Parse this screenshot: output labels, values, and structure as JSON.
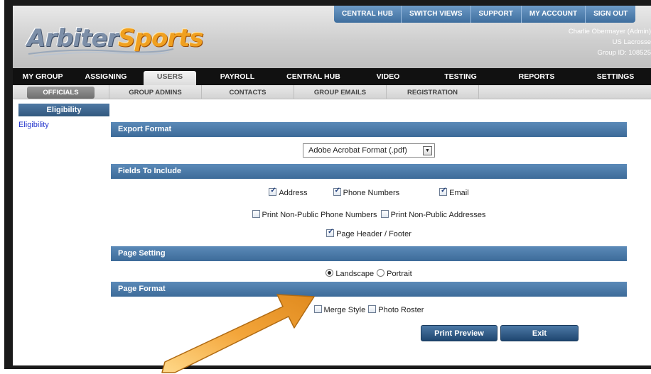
{
  "header": {
    "logo_part1": "Arbiter",
    "logo_part2": "Sports",
    "top_links": [
      "CENTRAL HUB",
      "SWITCH VIEWS",
      "SUPPORT",
      "MY ACCOUNT",
      "SIGN OUT"
    ],
    "user_name": "Charlie Obermayer (Admin)",
    "group_name": "US Lacrosse",
    "group_id": "Group ID: 108525"
  },
  "main_nav": [
    "MY GROUP",
    "ASSIGNING",
    "USERS",
    "PAYROLL",
    "CENTRAL HUB",
    "VIDEO",
    "TESTING",
    "REPORTS",
    "SETTINGS"
  ],
  "main_nav_active": "USERS",
  "sub_nav": [
    "OFFICIALS",
    "GROUP ADMINS",
    "CONTACTS",
    "GROUP EMAILS",
    "REGISTRATION"
  ],
  "sub_nav_active": "OFFICIALS",
  "sidebar": {
    "heading": "Eligibility",
    "link": "Eligibility"
  },
  "export_format": {
    "heading": "Export Format",
    "selected": "Adobe Acrobat Format (.pdf)"
  },
  "fields": {
    "heading": "Fields To Include",
    "address": {
      "label": "Address",
      "checked": true
    },
    "phone": {
      "label": "Phone Numbers",
      "checked": true
    },
    "email": {
      "label": "Email",
      "checked": true
    },
    "nonpublic_phone": {
      "label": "Print Non-Public Phone Numbers",
      "checked": false
    },
    "nonpublic_address": {
      "label": "Print Non-Public Addresses",
      "checked": false
    },
    "page_header": {
      "label": "Page Header / Footer",
      "checked": true
    }
  },
  "page_setting": {
    "heading": "Page Setting",
    "landscape": "Landscape",
    "portrait": "Portrait",
    "selected": "Landscape"
  },
  "page_format": {
    "heading": "Page Format",
    "merge": {
      "label": "Merge Style",
      "checked": false
    },
    "photo": {
      "label": "Photo Roster",
      "checked": false
    }
  },
  "buttons": {
    "preview": "Print Preview",
    "exit": "Exit"
  },
  "colors": {
    "band_blue": "#4a78a6",
    "arrow_orange": "#f3a53a",
    "link_blue": "#2233cc"
  }
}
